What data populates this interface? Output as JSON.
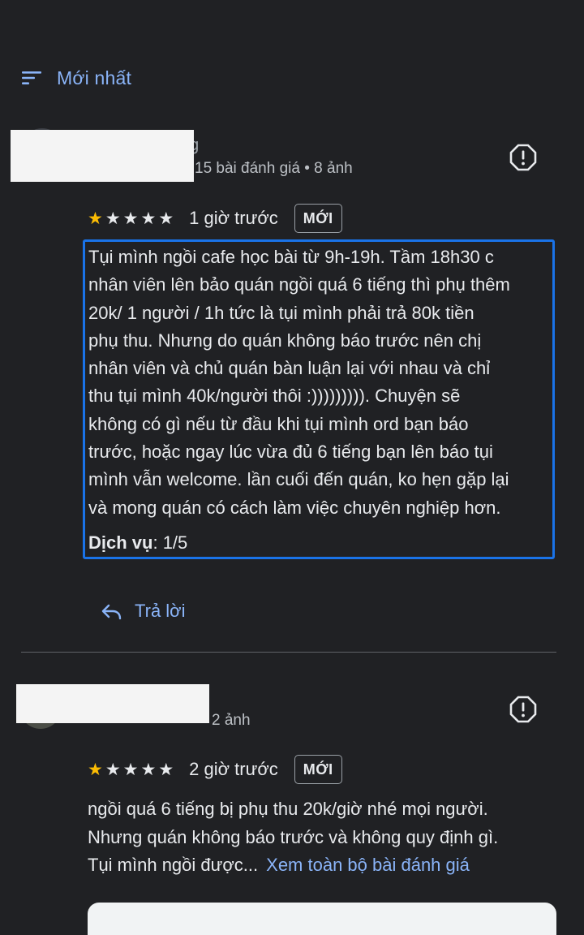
{
  "sort": {
    "label": "Mới nhất",
    "icon": "sort-icon"
  },
  "reviews": [
    {
      "author_name_fragment": "g",
      "meta": "15 bài đánh giá • 8 ảnh",
      "stars_filled": 1,
      "stars_total": 5,
      "time": "1 giờ trước",
      "badge": "MỚI",
      "text": "Tụi mình ngồi cafe học bài từ 9h-19h. Tầm 18h30 c\nnhân viên lên bảo quán ngồi quá 6 tiếng thì phụ thêm\n20k/ 1 người / 1h tức là tụi mình phải trả 80k tiền\nphụ thu. Nhưng do quán không báo trước nên chị\nnhân viên và chủ quán bàn luận lại với nhau và chỉ\nthu tụi mình 40k/người thôi :))))))))). Chuyện sẽ\nkhông có gì nếu từ đầu khi tụi mình ord bạn báo\ntrước, hoặc ngay lúc vừa đủ 6 tiếng bạn lên báo tụi\nmình vẫn welcome. lần cuối đến quán, ko hẹn gặp lại\nvà mong quán có cách làm việc chuyên nghiệp hơn.",
      "service_label": "Dịch vụ",
      "service_value": ": 1/5",
      "reply_label": "Trả lời"
    },
    {
      "meta": "2 ảnh",
      "stars_filled": 1,
      "stars_total": 5,
      "time": "2 giờ trước",
      "badge": "MỚI",
      "text_lines": [
        "ngồi quá 6 tiếng bị phụ thu 20k/giờ nhé mọi người.",
        "Nhưng quán không báo trước và không quy định gì.",
        "Tụi mình ngồi được..."
      ],
      "more_link": "Xem toàn bộ bài đánh giá"
    }
  ],
  "colors": {
    "background": "#202124",
    "accent": "#8ab4f8",
    "star": "#fbbc04",
    "highlight_border": "#1a73e8"
  }
}
